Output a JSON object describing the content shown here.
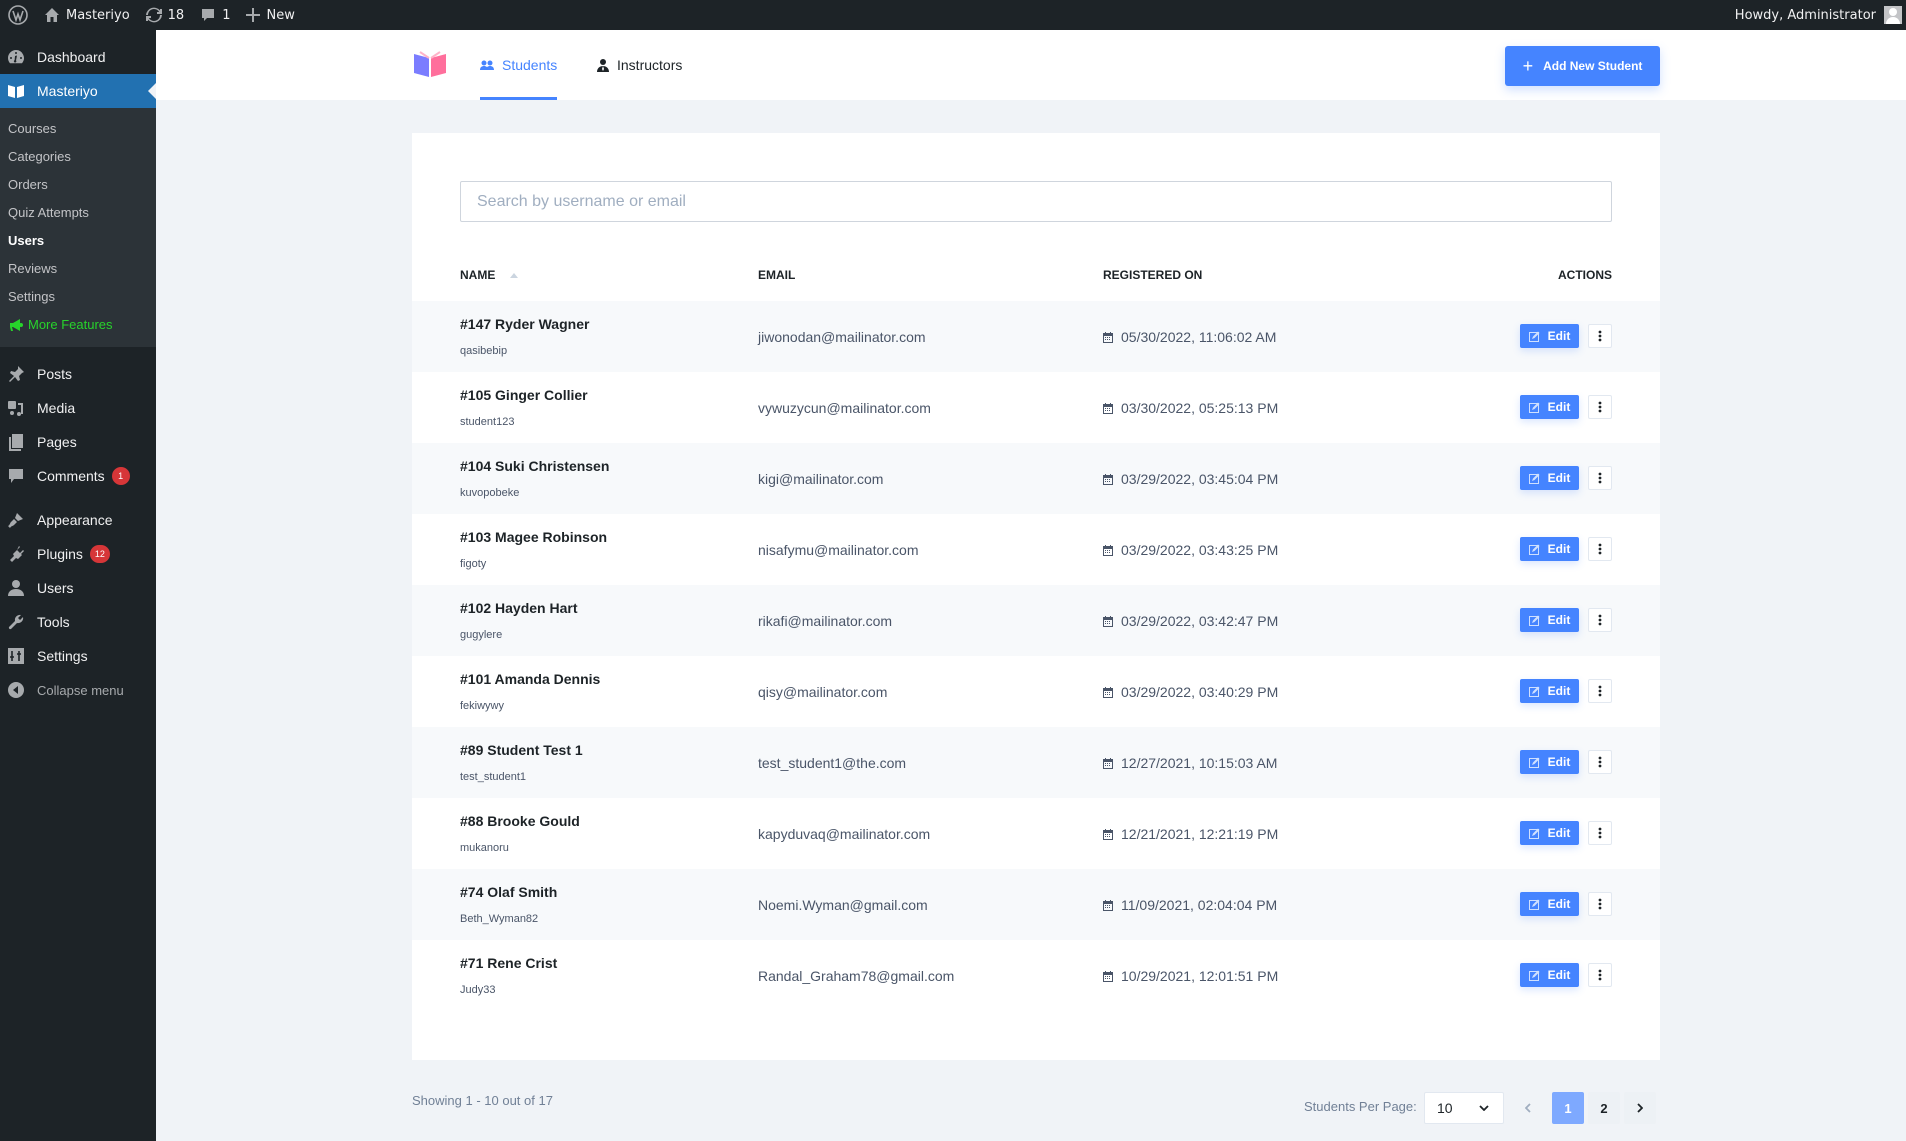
{
  "adminbar": {
    "site_name": "Masteriyo",
    "updates_count": "18",
    "comments_count": "1",
    "new_label": "New",
    "greeting": "Howdy, Administrator"
  },
  "sidebar": {
    "dashboard": "Dashboard",
    "masteriyo": "Masteriyo",
    "submenu": [
      "Courses",
      "Categories",
      "Orders",
      "Quiz Attempts",
      "Users",
      "Reviews",
      "Settings",
      "More Features"
    ],
    "current_submenu": "Users",
    "posts": "Posts",
    "media": "Media",
    "pages": "Pages",
    "comments": "Comments",
    "comments_badge": "1",
    "appearance": "Appearance",
    "plugins": "Plugins",
    "plugins_badge": "12",
    "users": "Users",
    "tools": "Tools",
    "settings": "Settings",
    "collapse": "Collapse menu"
  },
  "header": {
    "tabs": [
      {
        "label": "Students",
        "active": true
      },
      {
        "label": "Instructors",
        "active": false
      }
    ],
    "add_button": "Add New Student"
  },
  "search": {
    "placeholder": "Search by username or email",
    "value": ""
  },
  "table": {
    "columns": [
      "NAME",
      "EMAIL",
      "REGISTERED ON",
      "ACTIONS"
    ],
    "sort": {
      "column": "NAME",
      "direction": "asc"
    },
    "edit_label": "Edit",
    "rows": [
      {
        "name": "#147 Ryder Wagner",
        "username": "qasibebip",
        "email": "jiwonodan@mailinator.com",
        "registered": "05/30/2022, 11:06:02 AM"
      },
      {
        "name": "#105 Ginger Collier",
        "username": "student123",
        "email": "vywuzycun@mailinator.com",
        "registered": "03/30/2022, 05:25:13 PM"
      },
      {
        "name": "#104 Suki Christensen",
        "username": "kuvopobeke",
        "email": "kigi@mailinator.com",
        "registered": "03/29/2022, 03:45:04 PM"
      },
      {
        "name": "#103 Magee Robinson",
        "username": "figoty",
        "email": "nisafymu@mailinator.com",
        "registered": "03/29/2022, 03:43:25 PM"
      },
      {
        "name": "#102 Hayden Hart",
        "username": "gugylere",
        "email": "rikafi@mailinator.com",
        "registered": "03/29/2022, 03:42:47 PM"
      },
      {
        "name": "#101 Amanda Dennis",
        "username": "fekiwywy",
        "email": "qisy@mailinator.com",
        "registered": "03/29/2022, 03:40:29 PM"
      },
      {
        "name": "#89 Student Test 1",
        "username": "test_student1",
        "email": "test_student1@the.com",
        "registered": "12/27/2021, 10:15:03 AM"
      },
      {
        "name": "#88 Brooke Gould",
        "username": "mukanoru",
        "email": "kapyduvaq@mailinator.com",
        "registered": "12/21/2021, 12:21:19 PM"
      },
      {
        "name": "#74 Olaf Smith",
        "username": "Beth_Wyman82",
        "email": "Noemi.Wyman@gmail.com",
        "registered": "11/09/2021, 02:04:04 PM"
      },
      {
        "name": "#71 Rene Crist",
        "username": "Judy33",
        "email": "Randal_Graham78@gmail.com",
        "registered": "10/29/2021, 12:01:51 PM"
      }
    ]
  },
  "footer": {
    "showing": "Showing 1 - 10 out of 17",
    "per_page_label": "Students Per Page:",
    "per_page_value": "10",
    "pages": [
      "1",
      "2"
    ],
    "current_page": "1"
  },
  "colors": {
    "accent": "#4584ff",
    "wp_active": "#2271b1",
    "more_features": "#27d42b",
    "badge": "#d63638"
  }
}
